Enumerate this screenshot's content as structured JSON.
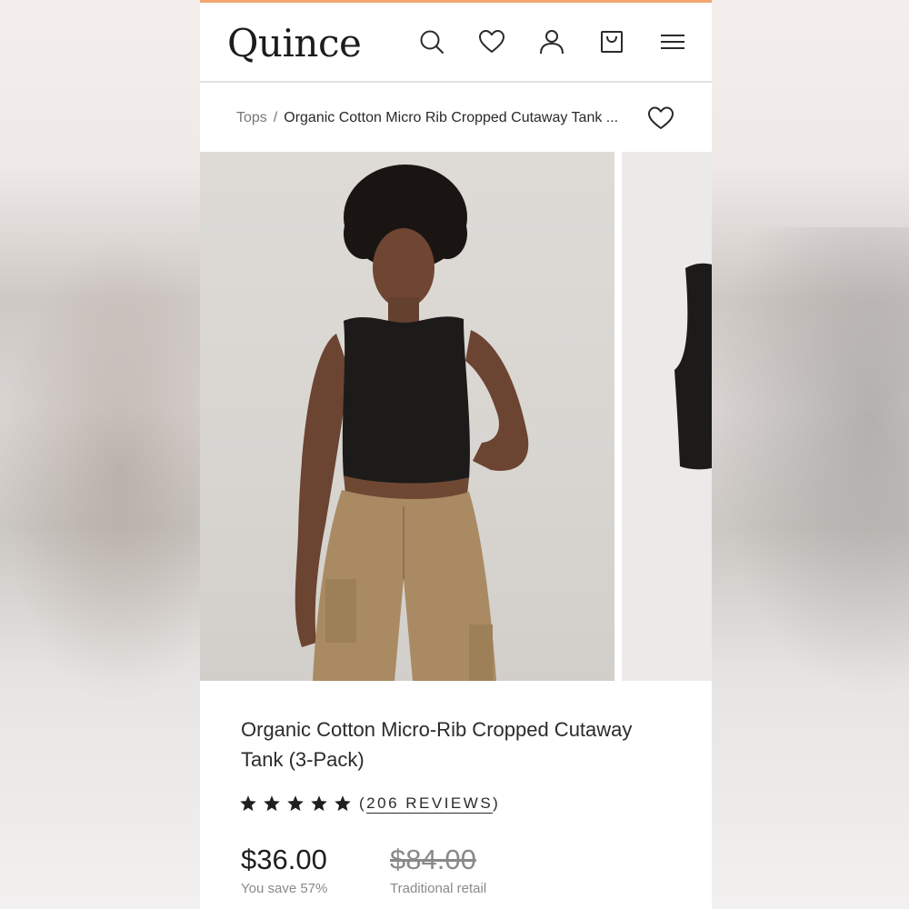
{
  "header": {
    "logo": "Quince",
    "icons": [
      "search-icon",
      "heart-icon",
      "user-icon",
      "bag-icon",
      "menu-icon"
    ]
  },
  "breadcrumb": {
    "parent": "Tops",
    "separator": "/",
    "current": "Organic Cotton Micro Rib Cropped Cutaway Tank ..."
  },
  "product": {
    "title": "Organic Cotton Micro-Rib Cropped Cutaway Tank (3-Pack)",
    "rating": 5,
    "reviews_open": "(",
    "reviews_label": "206 REVIEWS",
    "reviews_close": ")",
    "price": "$36.00",
    "savings": "You save 57%",
    "retail_price": "$84.00",
    "retail_label": "Traditional retail"
  },
  "colors": {
    "accent": "#f1a772",
    "text": "#2b2b2b",
    "muted": "#8a8a8a"
  }
}
